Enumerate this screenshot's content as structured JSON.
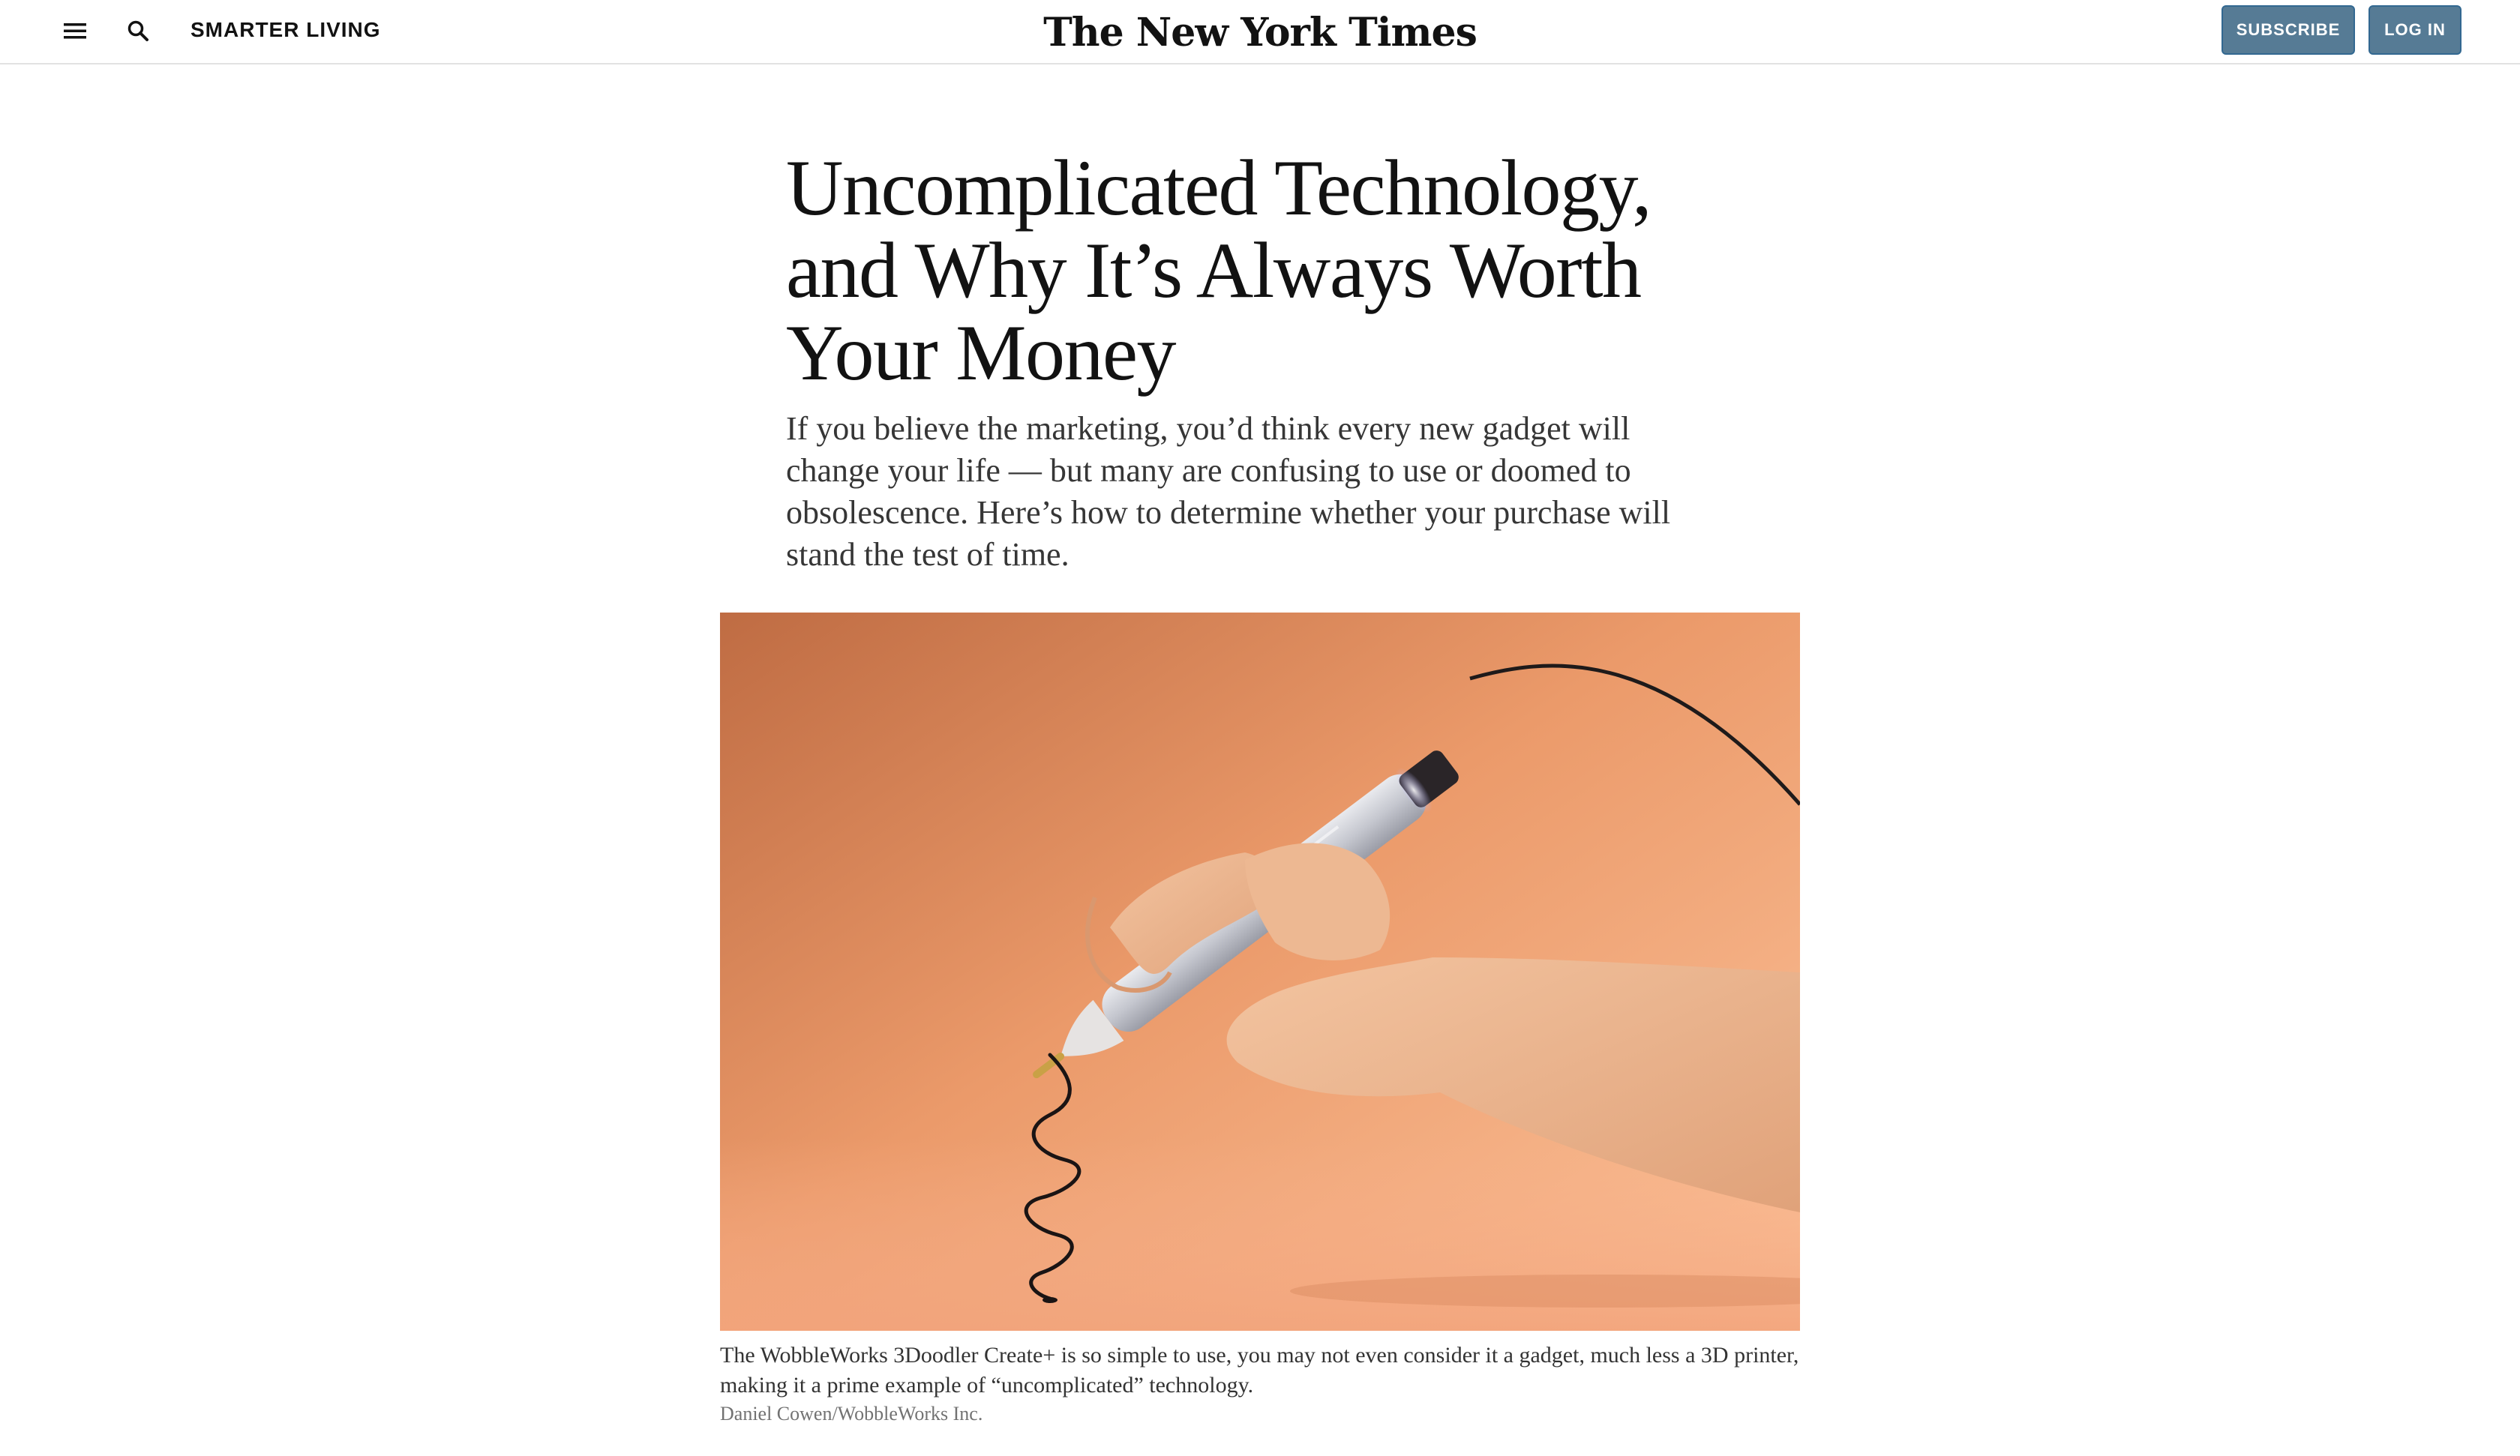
{
  "header": {
    "section_label": "SMARTER LIVING",
    "masthead": "The New York Times",
    "subscribe_label": "SUBSCRIBE",
    "login_label": "LOG IN",
    "menu_icon": "hamburger-menu-icon",
    "search_icon": "search-icon"
  },
  "article": {
    "headline": "Uncomplicated Technology, and Why It’s Always Worth Your Money",
    "summary": "If you believe the marketing, you’d think every new gadget will change your life — but many are confusing to use or doomed to obsolescence. Here’s how to determine whether your purchase will stand the test of time.",
    "lead_image": {
      "caption": "The WobbleWorks 3Doodler Create+ is so simple to use, you may not even consider it a gadget, much less a 3D printer, making it a prime example of “uncomplicated” technology.",
      "credit": "Daniel Cowen/WobbleWorks Inc."
    }
  },
  "colors": {
    "button_bg": "#567b95",
    "button_border": "#326891",
    "text_primary": "#121212",
    "image_bg_light": "#f9b98a",
    "image_bg_dark": "#c8764c"
  }
}
